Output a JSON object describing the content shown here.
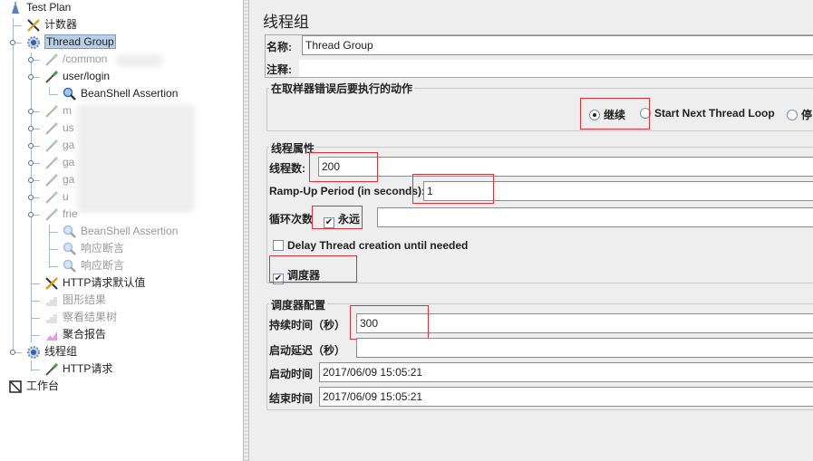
{
  "tree": {
    "items": [
      {
        "label": "Test Plan",
        "icon": "test-plan-icon",
        "gray": false
      },
      {
        "label": "计数器",
        "icon": "config-tools-icon",
        "gray": false
      },
      {
        "label": "Thread Group",
        "icon": "thread-group-gear-icon",
        "gray": false,
        "selected": true
      },
      {
        "label": "/common",
        "icon": "sampler-pipette-icon",
        "gray": true
      },
      {
        "label": "user/login",
        "icon": "sampler-pipette-icon",
        "gray": false
      },
      {
        "label": "BeanShell Assertion",
        "icon": "assertion-magnifier-icon",
        "gray": false
      },
      {
        "label": "m",
        "icon": "sampler-pipette-icon",
        "gray": true
      },
      {
        "label": "us",
        "icon": "sampler-pipette-icon",
        "gray": true
      },
      {
        "label": "ga",
        "icon": "sampler-pipette-icon",
        "gray": true
      },
      {
        "label": "ga",
        "icon": "sampler-pipette-icon",
        "gray": true
      },
      {
        "label": "ga",
        "icon": "sampler-pipette-icon",
        "gray": true
      },
      {
        "label": "u",
        "icon": "sampler-pipette-icon",
        "gray": true
      },
      {
        "label": "frie",
        "icon": "sampler-pipette-icon",
        "gray": true
      },
      {
        "label": "BeanShell Assertion",
        "icon": "assertion-magnifier-icon",
        "gray": true
      },
      {
        "label": "响应断言",
        "icon": "assertion-magnifier-icon",
        "gray": true
      },
      {
        "label": "响应断言",
        "icon": "assertion-magnifier-icon",
        "gray": true
      },
      {
        "label": "HTTP请求默认值",
        "icon": "config-tools-icon",
        "gray": false
      },
      {
        "label": "图形结果",
        "icon": "listener-chart-icon",
        "gray": true
      },
      {
        "label": "察看结果树",
        "icon": "listener-chart-icon",
        "gray": true
      },
      {
        "label": "聚合报告",
        "icon": "listener-report-icon",
        "gray": false
      },
      {
        "label": "线程组",
        "icon": "thread-group-gear-icon",
        "gray": false
      },
      {
        "label": "HTTP请求",
        "icon": "sampler-pipette-icon",
        "gray": false
      },
      {
        "label": "工作台",
        "icon": "workbench-icon",
        "gray": false
      }
    ]
  },
  "panel": {
    "title": "线程组",
    "name_label": "名称:",
    "name_value": "Thread Group",
    "comment_label": "注释:",
    "comment_value": "",
    "error_action": {
      "title": "在取样器错误后要执行的动作",
      "options": [
        "继续",
        "Start Next Thread Loop",
        "停"
      ],
      "selected": "继续"
    },
    "thread_props": {
      "title": "线程属性",
      "threads_label": "线程数:",
      "threads_value": "200",
      "rampup_label": "Ramp-Up Period (in seconds):",
      "rampup_value": "1",
      "loop_label": "循环次数",
      "forever_label": "永远",
      "forever_checked": true,
      "delay_label": "Delay Thread creation until needed",
      "delay_checked": false,
      "scheduler_label": "调度器",
      "scheduler_checked": true
    },
    "scheduler": {
      "title": "调度器配置",
      "duration_label": "持续时间（秒）",
      "duration_value": "300",
      "delay_label": "启动延迟（秒）",
      "delay_value": "",
      "start_label": "启动时间",
      "start_value": "2017/06/09 15:05:21",
      "end_label": "结束时间",
      "end_value": "2017/06/09 15:05:21"
    },
    "highlight_color": "#e0303a"
  }
}
